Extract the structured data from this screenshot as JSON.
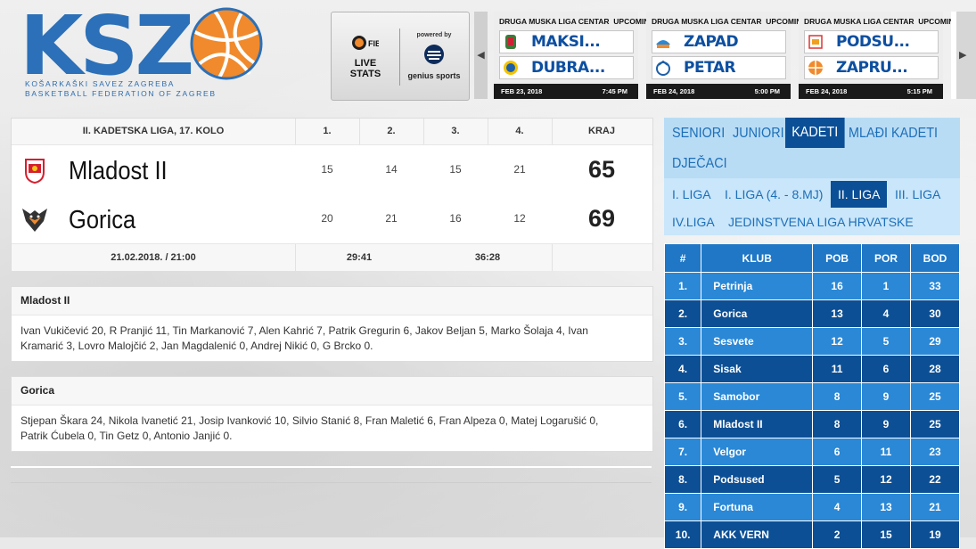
{
  "logo": {
    "text": "KSZ",
    "line1": "KOŠARKAŠKI SAVEZ ZAGREBA",
    "line2": "BASKETBALL FEDERATION OF ZAGREB"
  },
  "live_stats": {
    "fiba": "FIBA",
    "label": "LIVE STATS",
    "powered_by": "powered by",
    "provider": "genius sports"
  },
  "ticker": {
    "prev_icon": "chevron-left-icon",
    "next_icon": "chevron-right-icon",
    "games": [
      {
        "league": "DRUGA MUSKA LIGA CENTAR",
        "status": "UPCOMING",
        "home": "MAKSI...",
        "away": "DUBRA...",
        "date": "FEB 23, 2018",
        "time": "7:45 PM"
      },
      {
        "league": "DRUGA MUSKA LIGA CENTAR",
        "status": "UPCOMING",
        "home": "ZAPAD",
        "away": "PETAR",
        "date": "FEB 24, 2018",
        "time": "5:00 PM"
      },
      {
        "league": "DRUGA MUSKA LIGA CENTAR",
        "status": "UPCOMING",
        "home": "PODSU...",
        "away": "ZAPRU...",
        "date": "FEB 24, 2018",
        "time": "5:15 PM"
      }
    ]
  },
  "game": {
    "title": "II. KADETSKA LIGA, 17. KOLO",
    "q_headers": [
      "1.",
      "2.",
      "3.",
      "4."
    ],
    "final_label": "KRAJ",
    "teams": [
      {
        "name": "Mladost II",
        "quarters": [
          "15",
          "14",
          "15",
          "21"
        ],
        "total": "65"
      },
      {
        "name": "Gorica",
        "quarters": [
          "20",
          "21",
          "16",
          "12"
        ],
        "total": "69"
      }
    ],
    "datetime": "21.02.2018. / 21:00",
    "half_score": "29:41",
    "third_score": "36:28"
  },
  "rosters": [
    {
      "team": "Mladost II",
      "players": "Ivan Vukičević 20, R Pranjić 11, Tin Markanović 7, Alen Kahrić 7, Patrik Gregurin 6, Jakov Beljan 5, Marko Šolaja 4, Ivan Kramarić 3, Lovro Malojčić 2, Jan Magdalenić 0, Andrej Nikić 0, G Brcko 0."
    },
    {
      "team": "Gorica",
      "players": "Stjepan Škara 24, Nikola Ivanetić 21, Josip Ivanković 10, Silvio Stanić 8, Fran Maletić 6, Fran Alpeza 0, Matej Logarušić 0, Patrik Ćubela 0, Tin Getz 0, Antonio Janjić 0."
    }
  ],
  "categories": [
    "SENIORI",
    "JUNIORI",
    "KADETI",
    "MLAĐI KADETI",
    "DJEČACI"
  ],
  "active_category": "KADETI",
  "leagues": [
    "I. LIGA",
    "I. LIGA (4. - 8.MJ)",
    "II. LIGA",
    "III. LIGA",
    "IV.LIGA",
    "JEDINSTVENA LIGA HRVATSKE"
  ],
  "active_league": "II. LIGA",
  "standings": {
    "headers": [
      "#",
      "KLUB",
      "POB",
      "POR",
      "BOD"
    ],
    "rows": [
      [
        "1.",
        "Petrinja",
        "16",
        "1",
        "33"
      ],
      [
        "2.",
        "Gorica",
        "13",
        "4",
        "30"
      ],
      [
        "3.",
        "Sesvete",
        "12",
        "5",
        "29"
      ],
      [
        "4.",
        "Sisak",
        "11",
        "6",
        "28"
      ],
      [
        "5.",
        "Samobor",
        "8",
        "9",
        "25"
      ],
      [
        "6.",
        "Mladost II",
        "8",
        "9",
        "25"
      ],
      [
        "7.",
        "Velgor",
        "6",
        "11",
        "23"
      ],
      [
        "8.",
        "Podsused",
        "5",
        "12",
        "22"
      ],
      [
        "9.",
        "Fortuna",
        "4",
        "13",
        "21"
      ],
      [
        "10.",
        "AKK VERN",
        "2",
        "15",
        "19"
      ]
    ]
  },
  "colors": {
    "brand_blue": "#0d4f94",
    "accent_blue": "#2a88d6",
    "light_blue": "#b9dcf5",
    "ball_orange": "#f08a2c"
  }
}
